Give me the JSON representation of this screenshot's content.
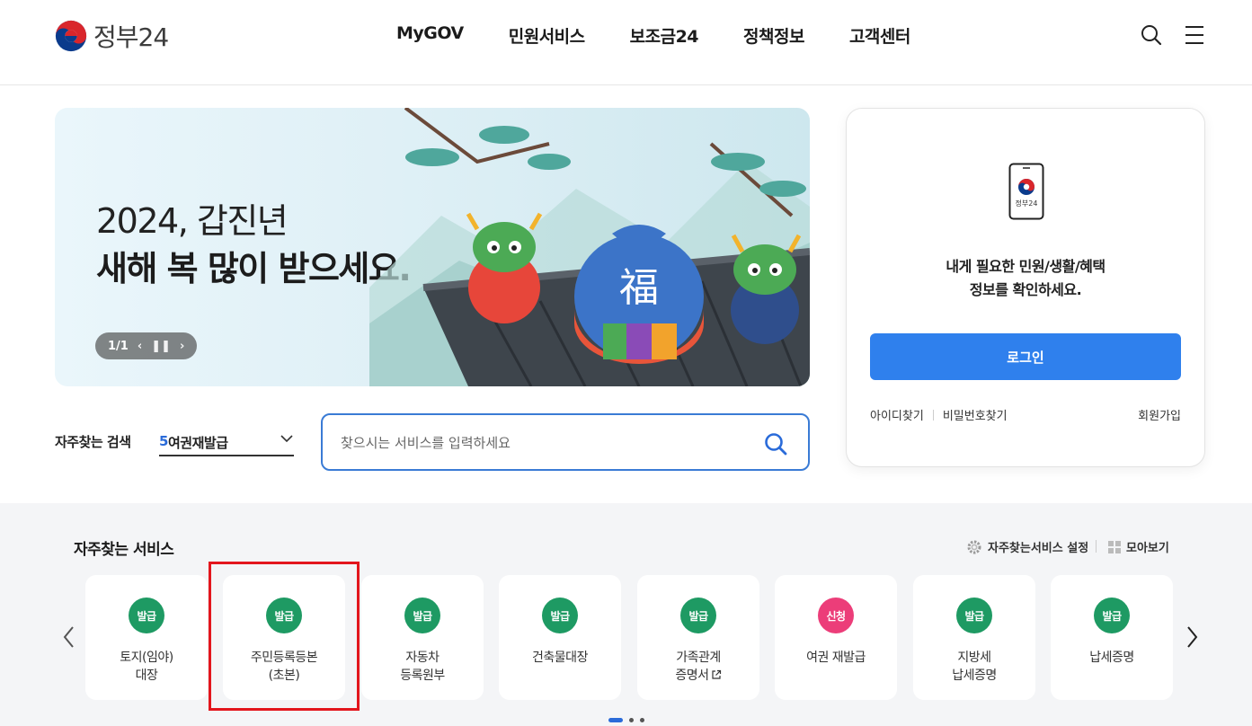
{
  "header": {
    "logo_text": "정부24",
    "nav": [
      "MyGOV",
      "민원서비스",
      "보조금24",
      "정책정보",
      "고객센터"
    ],
    "icons": [
      "search-icon",
      "menu-icon"
    ]
  },
  "banner": {
    "title_line1": "2024, 갑진년",
    "title_line2": "새해 복 많이 받으세요.",
    "pager": "1/1",
    "bag_character": "福"
  },
  "quick_search": {
    "label": "자주찾는 검색",
    "selected_rank": "5",
    "selected_text": "여권재발급",
    "placeholder": "찾으시는 서비스를 입력하세요"
  },
  "login": {
    "phone_label": "정부24",
    "message_line1": "내게 필요한 민원/생활/혜택",
    "message_line2": "정보를 확인하세요.",
    "button": "로그인",
    "find_id": "아이디찾기",
    "find_pw": "비밀번호찾기",
    "signup": "회원가입"
  },
  "favorites": {
    "title": "자주찾는 서비스",
    "settings_label": "자주찾는서비스 설정",
    "view_all_label": "모아보기",
    "cards": [
      {
        "badge": "발급",
        "badge_type": "green",
        "line1": "토지(임야)",
        "line2": "대장"
      },
      {
        "badge": "발급",
        "badge_type": "green",
        "line1": "주민등록등본",
        "line2": "(초본)"
      },
      {
        "badge": "발급",
        "badge_type": "green",
        "line1": "자동차",
        "line2": "등록원부"
      },
      {
        "badge": "발급",
        "badge_type": "green",
        "line1": "건축물대장",
        "line2": ""
      },
      {
        "badge": "발급",
        "badge_type": "green",
        "line1": "가족관계",
        "line2": "증명서"
      },
      {
        "badge": "신청",
        "badge_type": "pink",
        "line1": "여권 재발급",
        "line2": ""
      },
      {
        "badge": "발급",
        "badge_type": "green",
        "line1": "지방세",
        "line2": "납세증명"
      },
      {
        "badge": "발급",
        "badge_type": "green",
        "line1": "납세증명",
        "line2": ""
      }
    ]
  },
  "colors": {
    "primary": "#2f80ed",
    "badge_green": "#1e9a63",
    "badge_pink": "#ec3d79",
    "highlight": "#e3161d"
  }
}
